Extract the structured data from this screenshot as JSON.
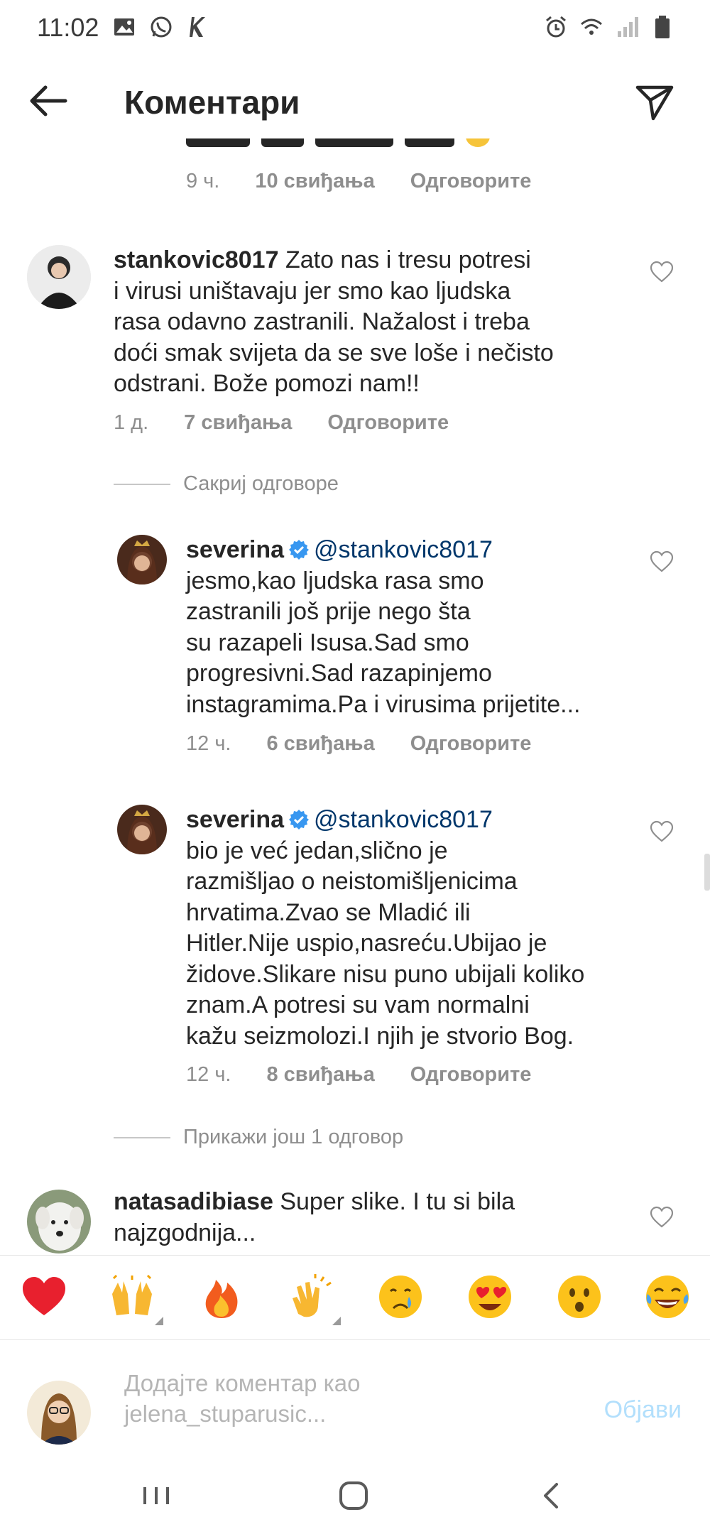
{
  "status_bar": {
    "time": "11:02"
  },
  "header": {
    "title": "Коментари"
  },
  "partial_comment": {
    "time": "9 ч.",
    "likes": "10 свиђања",
    "reply": "Одговорите"
  },
  "comments": [
    {
      "username": "stankovic8017",
      "lines": [
        "Zato nas i tresu potresi",
        "i virusi uništavaju jer smo kao ljudska",
        "rasa odavno zastranili. Nažalost i treba",
        "doći smak svijeta da se sve loše i nečisto",
        "odstrani. Bože pomozi nam!!"
      ],
      "time": "1 д.",
      "likes": "7 свиђања",
      "reply": "Одговорите"
    },
    {
      "username": "severina",
      "mention": "@stankovic8017",
      "lines": [
        "jesmo,kao ljudska rasa smo",
        "zastranili još prije nego šta",
        "su razapeli Isusa.Sad smo",
        "progresivni.Sad razapinjemo",
        "instagramima.Pa i virusima prijetite..."
      ],
      "time": "12 ч.",
      "likes": "6 свиђања",
      "reply": "Одговорите"
    },
    {
      "username": "severina",
      "mention": "@stankovic8017",
      "lines": [
        "bio je već jedan,slično je",
        "razmišljao o neistomišljenicima",
        "hrvatima.Zvao se Mladić ili",
        "Hitler.Nije uspio,nasreću.Ubijao je",
        "židove.Slikare nisu puno ubijali koliko",
        "znam.A potresi su vam normalni",
        "kažu seizmolozi.I njih je stvorio Bog."
      ],
      "time": "12 ч.",
      "likes": "8 свиђања",
      "reply": "Одговорите"
    },
    {
      "username": "natasadibiase",
      "lines": [
        "Super slike. I tu si bila",
        "najzgodnija..."
      ]
    }
  ],
  "hide_replies_label": "Сакриј одговоре",
  "show_more_label": "Прикажи још 1 одговор",
  "compose": {
    "placeholder_line1": "Додајте коментар као",
    "placeholder_line2": "jelena_stuparusic...",
    "post_label": "Објави"
  },
  "quick_emojis": [
    "heart",
    "raising-hands",
    "fire",
    "clapping-hands",
    "crying-face",
    "heart-eyes",
    "surprised-face",
    "tears-of-joy"
  ],
  "colors": {
    "link": "#00376b",
    "meta": "#8e8e8e",
    "post_disabled": "#b2dffc",
    "verified": "#3897f0"
  }
}
